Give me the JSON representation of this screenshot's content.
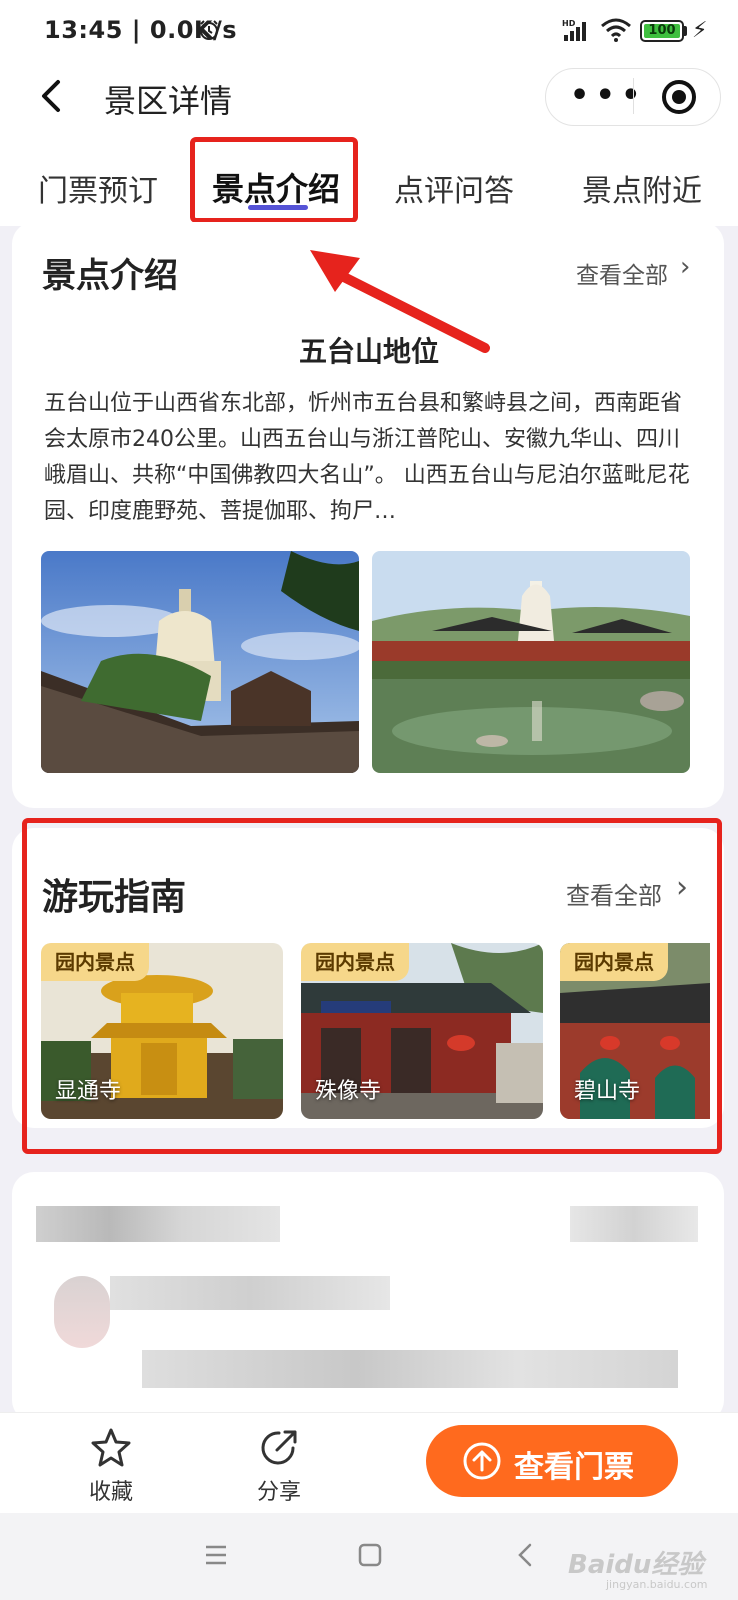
{
  "status_bar": {
    "time": "13:45 | 0.0K/s",
    "network": "HD",
    "battery": "100"
  },
  "nav": {
    "title": "景区详情",
    "more_icon": "more-dots-icon",
    "close_icon": "target-icon"
  },
  "tabs": [
    {
      "label": "门票预订"
    },
    {
      "label": "景点介绍"
    },
    {
      "label": "点评问答"
    },
    {
      "label": "景点附近"
    }
  ],
  "intro": {
    "title": "景点介绍",
    "see_all": "查看全部",
    "subtitle": "五台山地位",
    "text": "五台山位于山西省东北部，忻州市五台县和繁峙县之间，西南距省会太原市240公里。山西五台山与浙江普陀山、安徽九华山、四川峨眉山、共称“中国佛教四大名山”。 山西五台山与尼泊尔蓝毗尼花园、印度鹿野苑、菩提伽耶、拘尸…"
  },
  "guide": {
    "title": "游玩指南",
    "see_all": "查看全部",
    "items": [
      {
        "tag": "园内景点",
        "name": "显通寺"
      },
      {
        "tag": "园内景点",
        "name": "殊像寺"
      },
      {
        "tag": "园内景点",
        "name": "碧山寺"
      }
    ]
  },
  "bottom_bar": {
    "favorite": "收藏",
    "share": "分享",
    "cta": "查看门票"
  },
  "watermark": {
    "brand": "Baidu经验",
    "url": "jingyan.baidu.com"
  },
  "colors": {
    "accent_orange": "#ff6a1e",
    "tab_underline": "#5553d6",
    "highlight_red": "#e6231d",
    "tag_bg": "#f6d78a"
  }
}
